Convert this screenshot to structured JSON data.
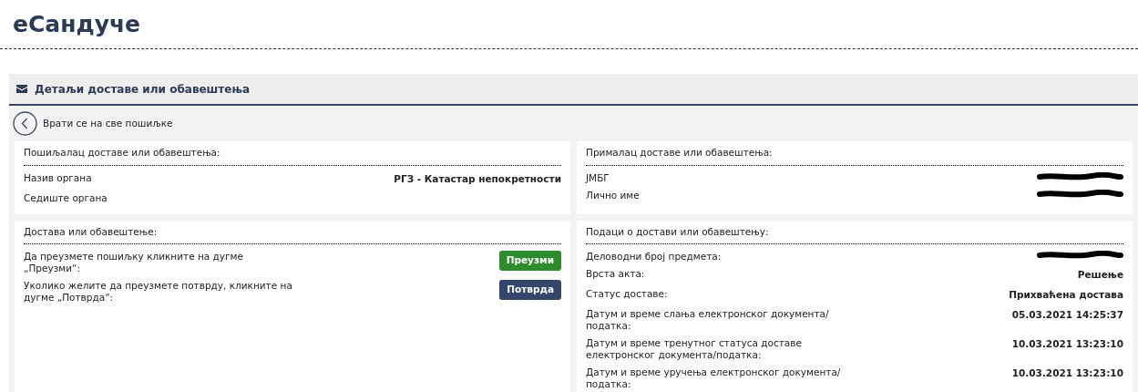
{
  "page_title": "еСандуче",
  "panel": {
    "title": "Детаљи доставе или обавештења",
    "back_link": "Врати се на све пошиљке"
  },
  "sections": [
    {
      "title": "Пошиљалац доставе или обавештења:",
      "rows": [
        {
          "kind": "field",
          "label": "Назив органа",
          "value": "РГЗ - Катастар непокретности",
          "redacted": false
        },
        {
          "kind": "field",
          "label": "Седиште органа",
          "redacted": false
        }
      ]
    },
    {
      "title": "Прималац доставе или обавештења:",
      "rows": [
        {
          "kind": "field",
          "label": "ЈМБГ",
          "redacted": true
        },
        {
          "kind": "field",
          "label": "Лично име",
          "redacted": true
        }
      ]
    },
    {
      "title": "Достава или обавештење:",
      "rows": [
        {
          "kind": "action",
          "label": "Да преузмете пошиљку кликните на дугме „Преузми“:",
          "button": "Преузми",
          "color": "#2e8b2e"
        },
        {
          "kind": "action",
          "label": "Уколико желите да преузмете потврду, кликните на дугме „Потврда“:",
          "button": "Потврда",
          "color": "#34466b"
        }
      ]
    },
    {
      "title": "Подаци о достави или обавештењу:",
      "rows": [
        {
          "kind": "field",
          "label": "Деловодни број предмета:",
          "redacted": true
        },
        {
          "kind": "field",
          "label": "Врста акта:",
          "value": "Решење",
          "redacted": false
        },
        {
          "kind": "field",
          "label": "Статус доставе:",
          "value": "Прихваћена достава",
          "redacted": false
        },
        {
          "kind": "field",
          "label": "Датум и време слања електронског документа/ податка:",
          "value": "05.03.2021 14:25:37",
          "redacted": false
        },
        {
          "kind": "field",
          "label": "Датум и време тренутног статуса доставе електронског документа/податка:",
          "value": "10.03.2021 13:23:10",
          "redacted": false
        },
        {
          "kind": "field",
          "label": "Датум и време уручења електронског документа/ податка:",
          "value": "10.03.2021 13:23:10",
          "redacted": false
        }
      ]
    }
  ]
}
